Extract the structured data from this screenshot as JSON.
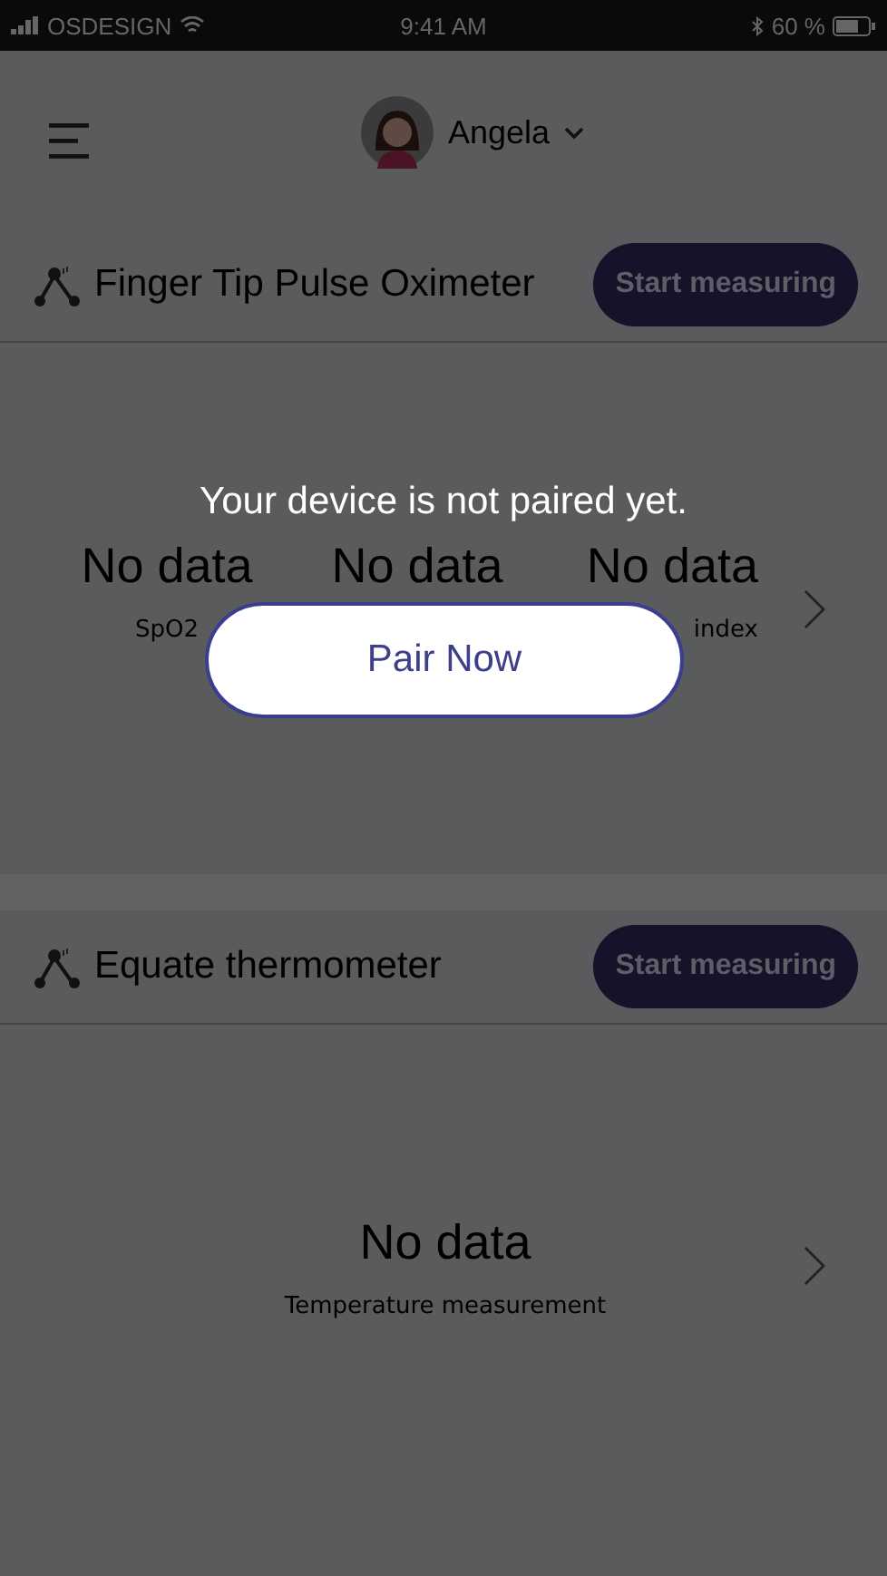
{
  "status_bar": {
    "carrier": "OSDESIGN",
    "time": "9:41 AM",
    "battery": "60 %"
  },
  "header": {
    "user": "Angela"
  },
  "devices": [
    {
      "name": "Finger Tip Pulse Oximeter",
      "button": "Start measuring",
      "metrics": [
        {
          "value": "No data",
          "label": "SpO2"
        },
        {
          "value": "No data"
        },
        {
          "value": "No data",
          "label": "index"
        }
      ]
    },
    {
      "name": "Equate thermometer",
      "button": "Start measuring",
      "metrics": [
        {
          "value": "No data",
          "label": "Temperature measurement"
        }
      ]
    }
  ],
  "dialog": {
    "message": "Your device is not paired yet.",
    "button": "Pair Now"
  }
}
